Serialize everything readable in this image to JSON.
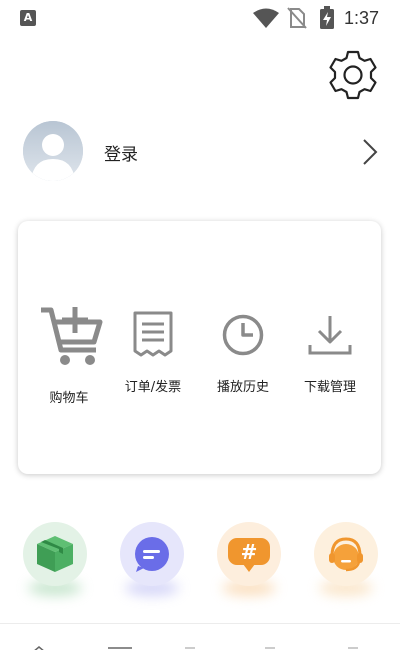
{
  "status_bar": {
    "time": "1:37",
    "left_icon_letter": "A",
    "icons": [
      "notification-a-icon",
      "wifi-icon",
      "no-sim-icon",
      "battery-charging-icon"
    ]
  },
  "profile": {
    "login_label": "登录"
  },
  "quick_actions": [
    {
      "label": "购物车",
      "icon": "shopping-cart-icon"
    },
    {
      "label": "订单/发票",
      "icon": "receipt-icon"
    },
    {
      "label": "播放历史",
      "icon": "clock-icon"
    },
    {
      "label": "下载管理",
      "icon": "download-icon"
    }
  ],
  "shortcuts": [
    {
      "icon": "package-box-icon",
      "color": "#4caf63",
      "bg": "#e3f2e6"
    },
    {
      "icon": "message-bubble-icon",
      "color": "#6a6de8",
      "bg": "#e6e6fb"
    },
    {
      "icon": "hashtag-bubble-icon",
      "color": "#f0962e",
      "bg": "#fdeedd"
    },
    {
      "icon": "customer-service-icon",
      "color": "#f5a13a",
      "bg": "#fdf0de"
    }
  ],
  "colors": {
    "icon_gray": "#8a8a8a",
    "text": "#222222"
  }
}
